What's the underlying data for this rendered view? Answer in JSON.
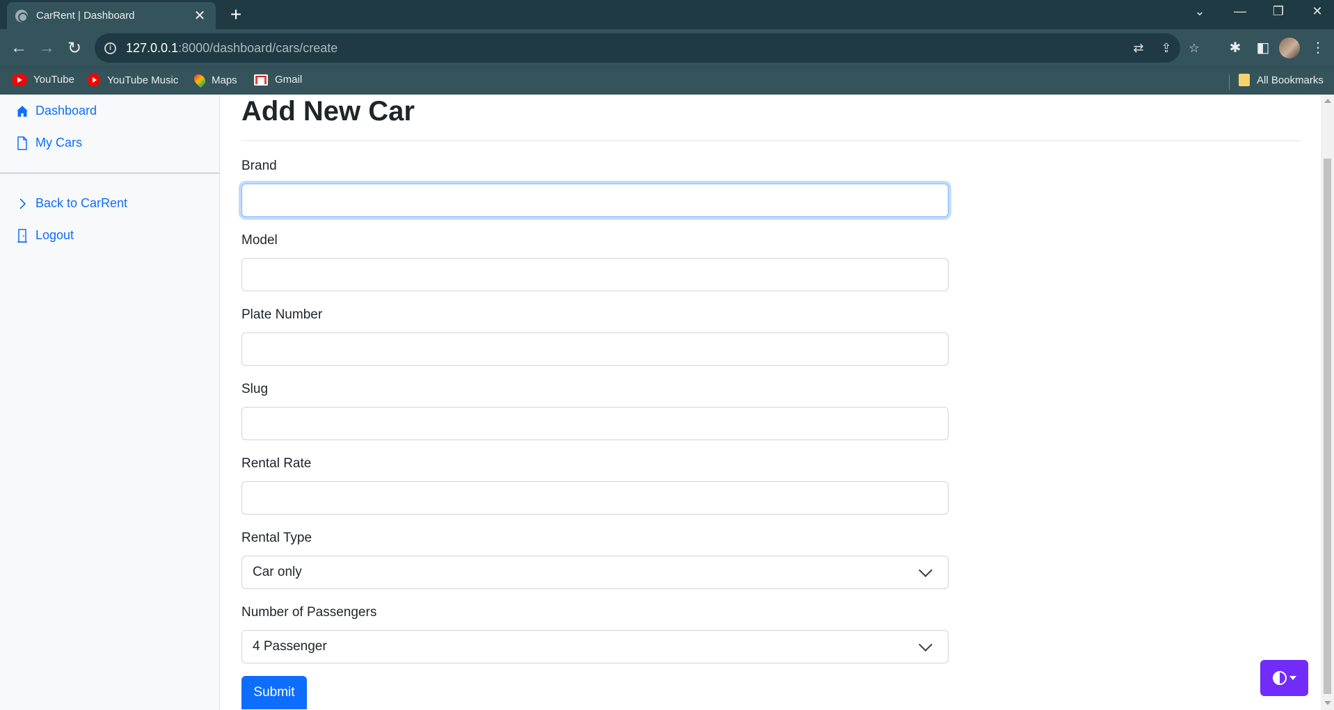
{
  "browser": {
    "tab_title": "CarRent | Dashboard",
    "url_host": "127.0.0.1",
    "url_rest": ":8000/dashboard/cars/create",
    "bookmarks": [
      {
        "label": "YouTube",
        "icon": "youtube-icon"
      },
      {
        "label": "YouTube Music",
        "icon": "youtube-music-icon"
      },
      {
        "label": "Maps",
        "icon": "maps-icon"
      },
      {
        "label": "Gmail",
        "icon": "gmail-icon"
      }
    ],
    "all_bookmarks_label": "All Bookmarks",
    "chrome_color": "#35535b"
  },
  "sidebar": {
    "items": [
      {
        "label": "Dashboard",
        "icon": "house-icon"
      },
      {
        "label": "My Cars",
        "icon": "file-icon"
      }
    ],
    "secondary_items": [
      {
        "label": "Back to CarRent",
        "icon": "chevron-right-icon"
      },
      {
        "label": "Logout",
        "icon": "door-icon"
      }
    ]
  },
  "main": {
    "title": "Add New Car",
    "fields": {
      "brand": {
        "label": "Brand",
        "value": ""
      },
      "model": {
        "label": "Model",
        "value": ""
      },
      "plate_number": {
        "label": "Plate Number",
        "value": ""
      },
      "slug": {
        "label": "Slug",
        "value": ""
      },
      "rental_rate": {
        "label": "Rental Rate",
        "value": ""
      },
      "rental_type": {
        "label": "Rental Type",
        "selected": "Car only"
      },
      "passengers": {
        "label": "Number of Passengers",
        "selected": "4 Passenger"
      }
    },
    "submit_label": "Submit"
  },
  "colors": {
    "primary": "#0d6efd",
    "theme_toggle": "#712cf9"
  }
}
